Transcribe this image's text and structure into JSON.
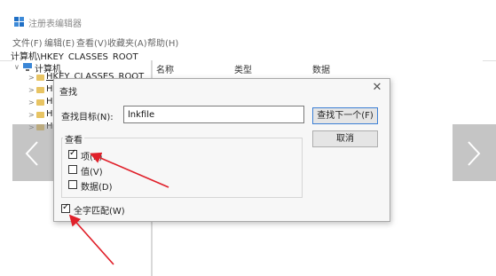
{
  "window": {
    "title": "注册表编辑器",
    "menu": [
      "文件(F)",
      "编辑(E)",
      "查看(V)",
      "收藏夹(A)",
      "帮助(H)"
    ],
    "address": "计算机\\HKEY_CLASSES_ROOT"
  },
  "tree": {
    "root_label": "计算机",
    "items": [
      "HKEY_CLASSES_ROOT",
      "HI",
      "HI",
      "HI",
      "HI"
    ]
  },
  "list": {
    "columns": [
      "名称",
      "类型",
      "数据"
    ]
  },
  "dialog": {
    "title": "查找",
    "find_label": "查找目标(N):",
    "find_value": "lnkfile",
    "find_next_button": "查找下一个(F)",
    "cancel_button": "取消",
    "look_at_label": "查看",
    "options": [
      {
        "label": "项(K)",
        "checked": true
      },
      {
        "label": "值(V)",
        "checked": false
      },
      {
        "label": "数据(D)",
        "checked": false
      }
    ],
    "match_whole": {
      "label": "全字匹配(W)",
      "checked": true
    }
  },
  "colors": {
    "annotation_arrow": "#e0202a",
    "side_arrow_bg": "#969696"
  },
  "icons": {
    "app": "registry-icon",
    "close": "close-icon",
    "prev": "chevron-left-icon",
    "next": "chevron-right-icon"
  }
}
